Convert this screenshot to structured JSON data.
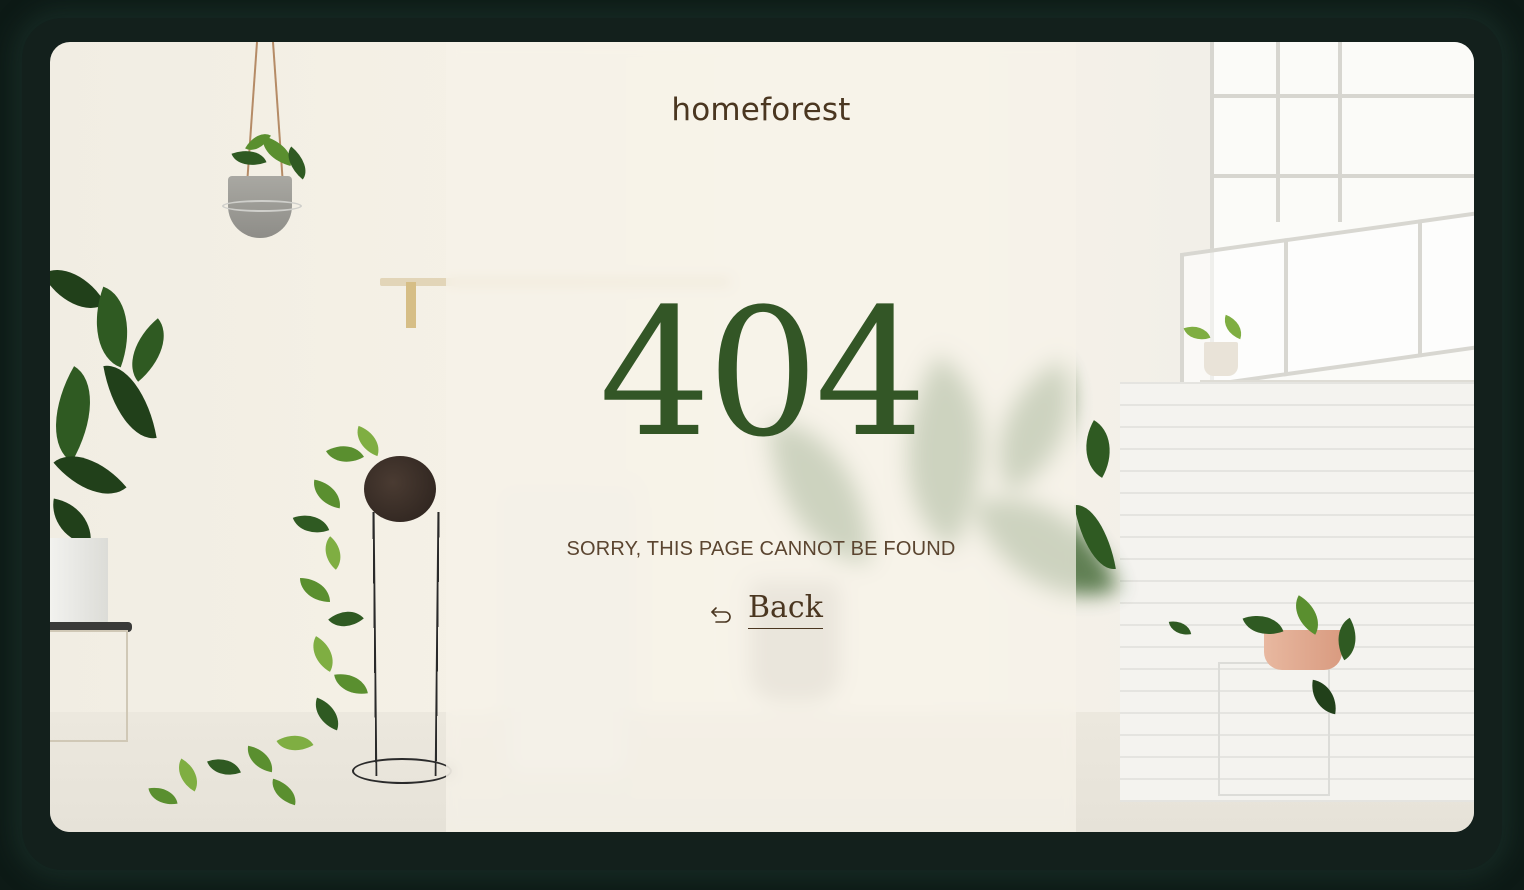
{
  "brand": {
    "logo_text": "homeforest"
  },
  "error": {
    "code": "404",
    "message": "SORRY, THIS PAGE CANNOT BE FOUND"
  },
  "navigation": {
    "back_label": "Back",
    "back_icon": "undo-arrow-icon"
  },
  "colors": {
    "brand_green": "#335626",
    "text_brown": "#4a3620",
    "panel": "#f6f2e9"
  }
}
